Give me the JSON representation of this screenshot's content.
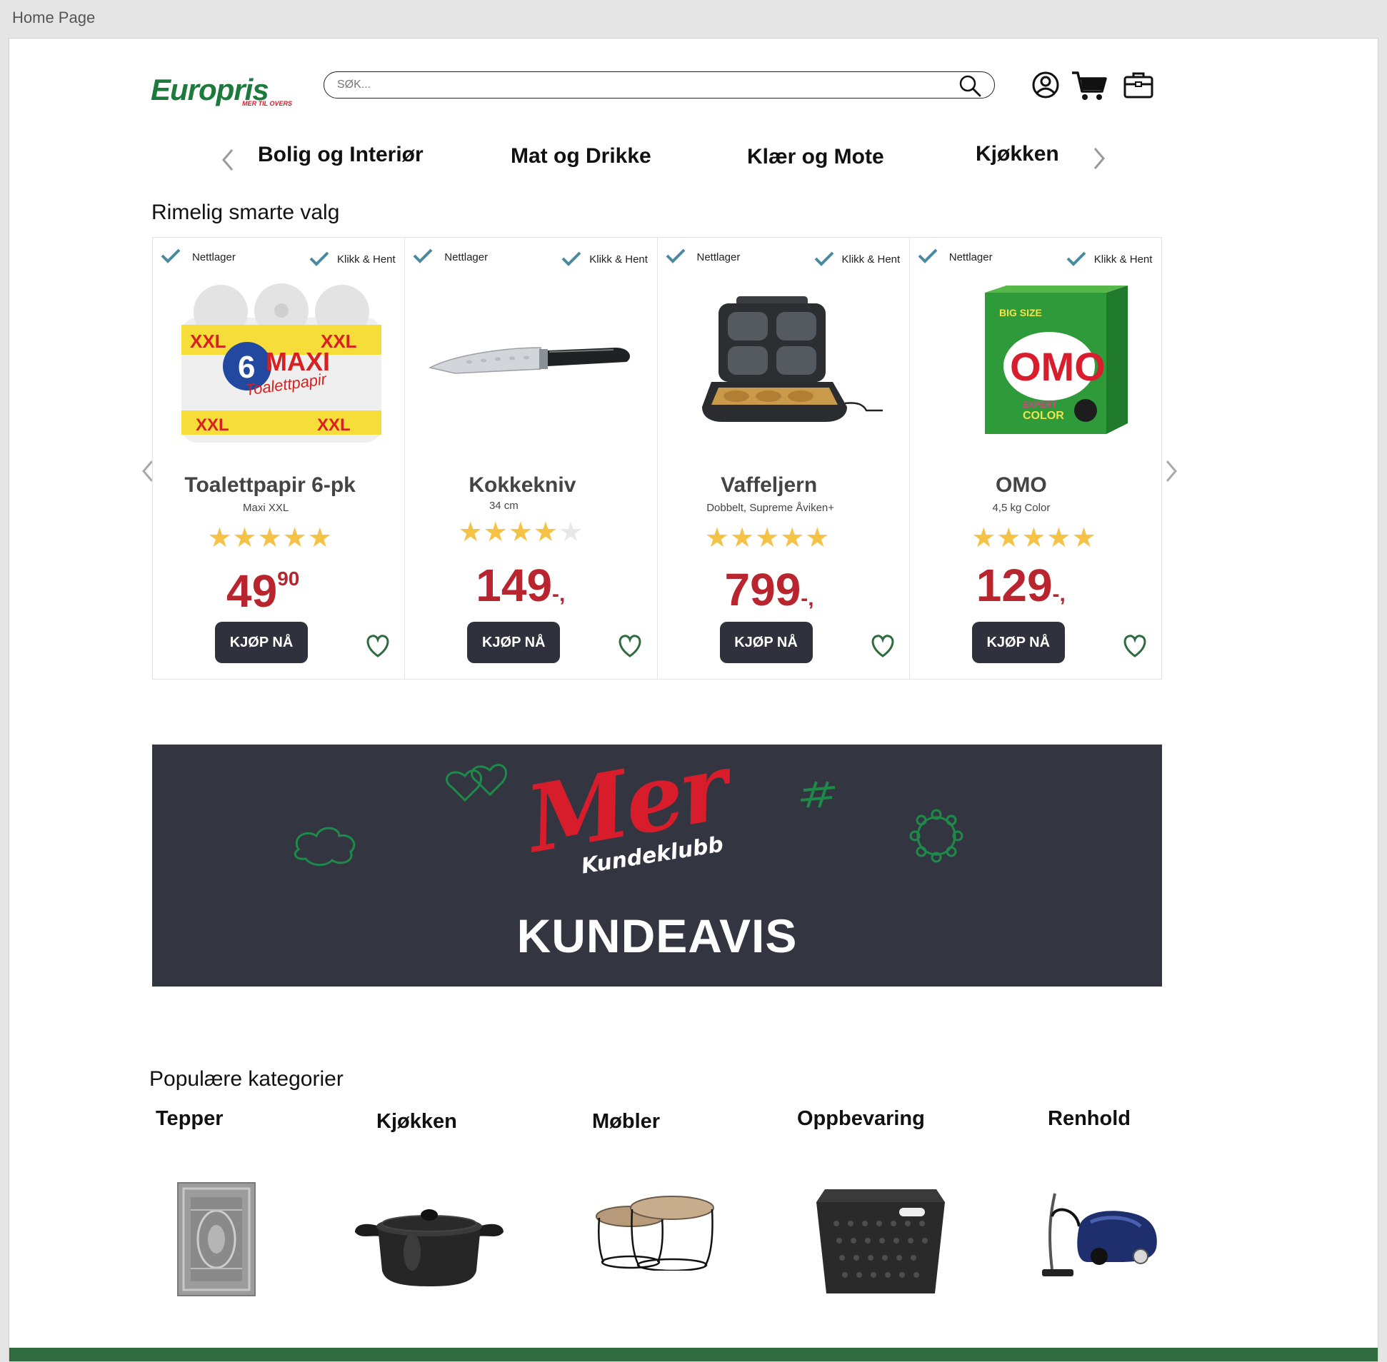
{
  "page_label": "Home Page",
  "header": {
    "logo_text": "Europris",
    "logo_tagline": "MER TIL OVERS",
    "search_placeholder": "SØK..."
  },
  "nav": {
    "items": [
      "Bolig og Interiør",
      "Mat og Drikke",
      "Klær og Mote",
      "Kjøkken"
    ]
  },
  "featured": {
    "title": "Rimelig smarte valg",
    "products": [
      {
        "badge_left": "Nettlager",
        "badge_right": "Klikk & Hent",
        "name": "Toalettpapir 6-pk",
        "subtitle": "Maxi XXL",
        "rating": 5,
        "price_main": "49",
        "price_sup": "90",
        "price_suffix": "",
        "buy_label": "KJØP NÅ",
        "image_text": {
          "big": "6",
          "maxi": "MAXI",
          "product": "Toalettpapir",
          "xxl": "XXL"
        }
      },
      {
        "badge_left": "Nettlager",
        "badge_right": "Klikk & Hent",
        "name": "Kokkekniv",
        "subtitle": "34 cm",
        "rating": 4,
        "price_main": "149",
        "price_sup": "",
        "price_suffix": "-,",
        "buy_label": "KJØP NÅ"
      },
      {
        "badge_left": "Nettlager",
        "badge_right": "Klikk & Hent",
        "name": "Vaffeljern",
        "subtitle": "Dobbelt, Supreme Åviken+",
        "rating": 5,
        "price_main": "799",
        "price_sup": "",
        "price_suffix": "-,",
        "buy_label": "KJØP NÅ"
      },
      {
        "badge_left": "Nettlager",
        "badge_right": "Klikk & Hent",
        "name": "OMO",
        "subtitle": "4,5 kg Color",
        "rating": 5,
        "price_main": "129",
        "price_sup": "",
        "price_suffix": "-,",
        "buy_label": "KJØP NÅ",
        "image_text": {
          "brand": "OMO",
          "big_size": "BIG SIZE",
          "line1": "EXPERT",
          "line2": "COLOR"
        }
      }
    ]
  },
  "banner": {
    "logo_word": "Mer",
    "logo_sub": "Kundeklubb",
    "title": "KUNDEAVIS"
  },
  "categories": {
    "title": "Populære kategorier",
    "items": [
      "Tepper",
      "Kjøkken",
      "Møbler",
      "Oppbevaring",
      "Renhold"
    ]
  },
  "colors": {
    "brand_green": "#1e7a3c",
    "brand_red": "#c8202d",
    "price_red": "#b8252f",
    "button_dark": "#2f323d",
    "star": "#f4c245",
    "tick_blue": "#4a8aa0",
    "heart_green": "#2f6b3e",
    "banner_bg": "#333640",
    "footer_green": "#2f6b3e"
  }
}
